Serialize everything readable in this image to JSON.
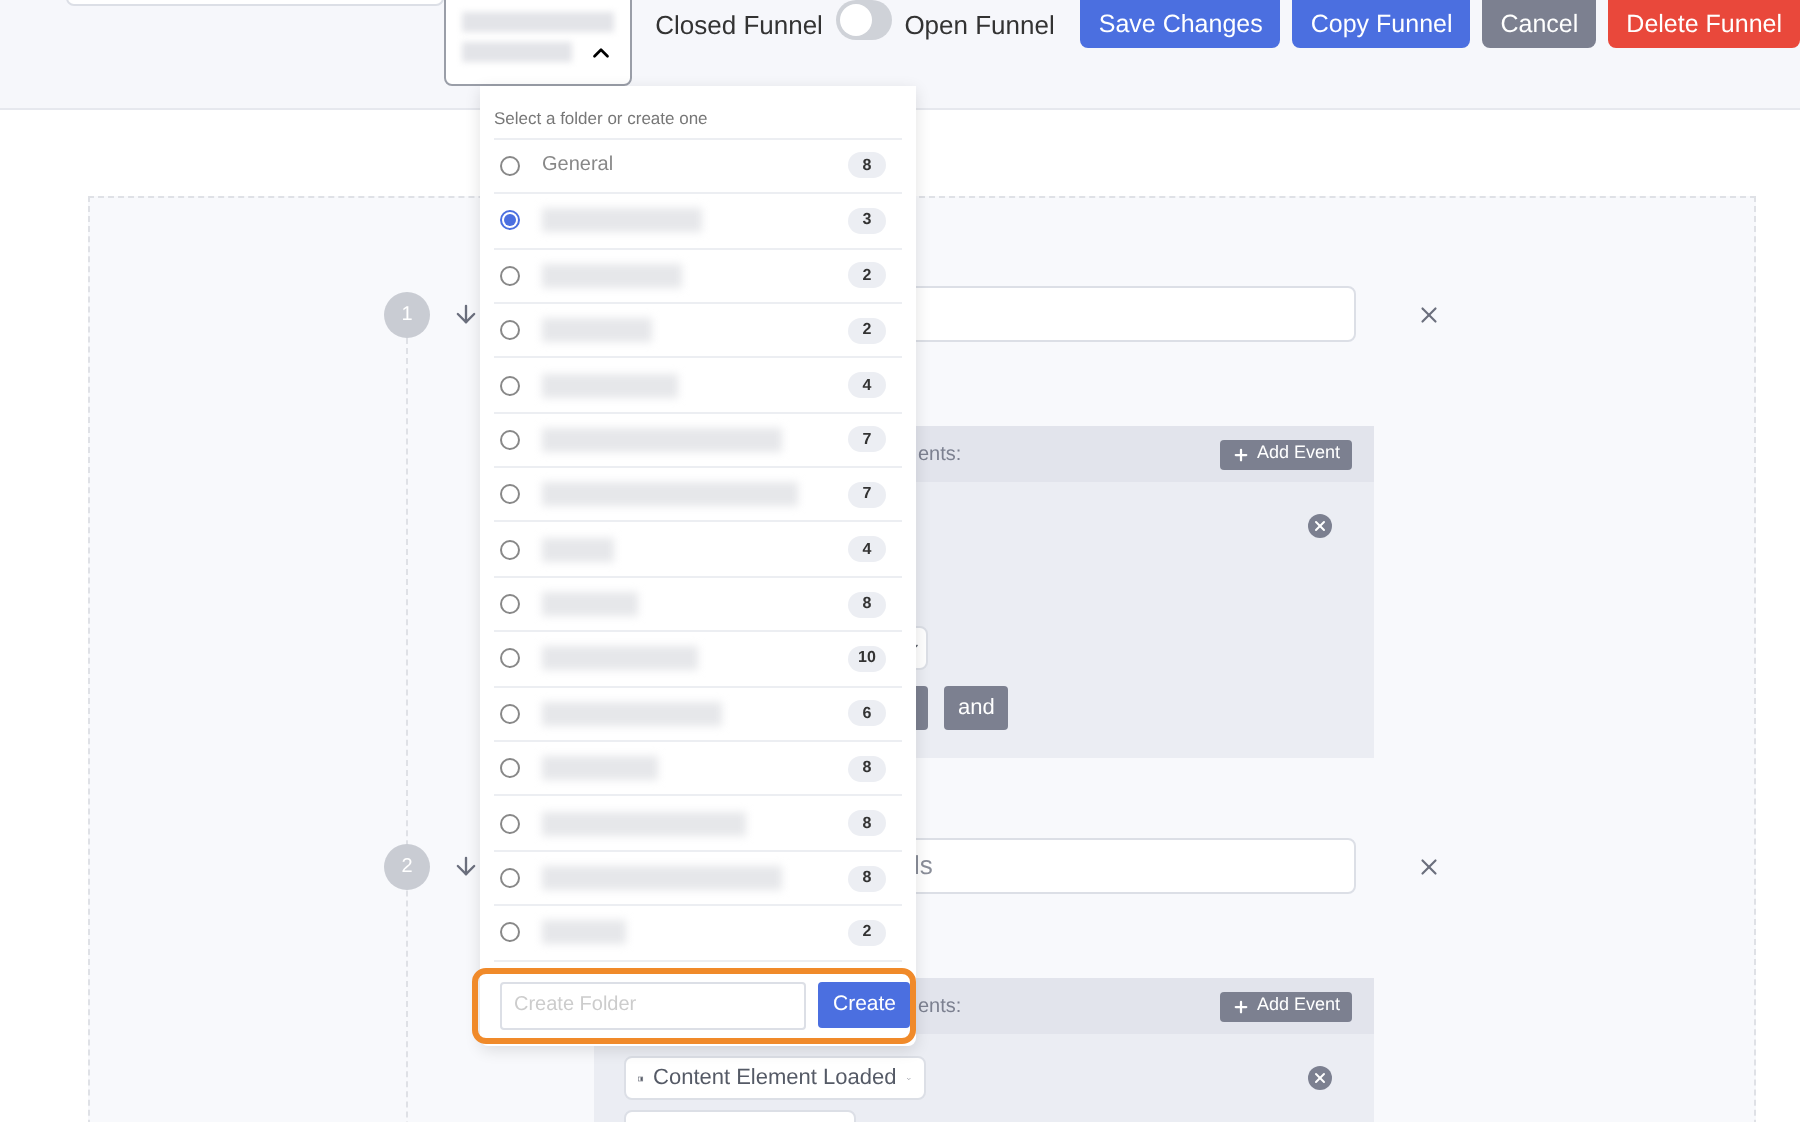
{
  "folder_select": {
    "expanded": true
  },
  "funnel_toggle": {
    "left_label": "Closed Funnel",
    "right_label": "Open Funnel",
    "on": false
  },
  "actions": [
    {
      "label": "Save Changes",
      "kind": "primary"
    },
    {
      "label": "Copy Funnel",
      "kind": "primary"
    },
    {
      "label": "Cancel",
      "kind": "secondary"
    },
    {
      "label": "Delete Funnel",
      "kind": "danger"
    }
  ],
  "steps": [
    {
      "number": "1",
      "events_label": "ents:",
      "add_event": "Add Event",
      "connector": "and"
    },
    {
      "number": "2",
      "value": "ls",
      "events_label": "ents:",
      "add_event": "Add Event",
      "trigger": "Content Element Loaded"
    }
  ],
  "folder_menu": {
    "heading": "Select a folder or create one",
    "folders": [
      {
        "label": "General",
        "count": "8",
        "selected": false
      },
      {
        "count": "3",
        "selected": true
      },
      {
        "count": "2",
        "selected": false
      },
      {
        "count": "2",
        "selected": false
      },
      {
        "count": "4",
        "selected": false
      },
      {
        "count": "7",
        "selected": false
      },
      {
        "count": "7",
        "selected": false
      },
      {
        "count": "4",
        "selected": false
      },
      {
        "count": "8",
        "selected": false
      },
      {
        "count": "10",
        "selected": false
      },
      {
        "count": "6",
        "selected": false
      },
      {
        "count": "8",
        "selected": false
      },
      {
        "count": "8",
        "selected": false
      },
      {
        "count": "8",
        "selected": false
      },
      {
        "count": "2",
        "selected": false
      }
    ],
    "create_placeholder": "Create Folder",
    "create_button": "Create",
    "highlighted": true
  }
}
